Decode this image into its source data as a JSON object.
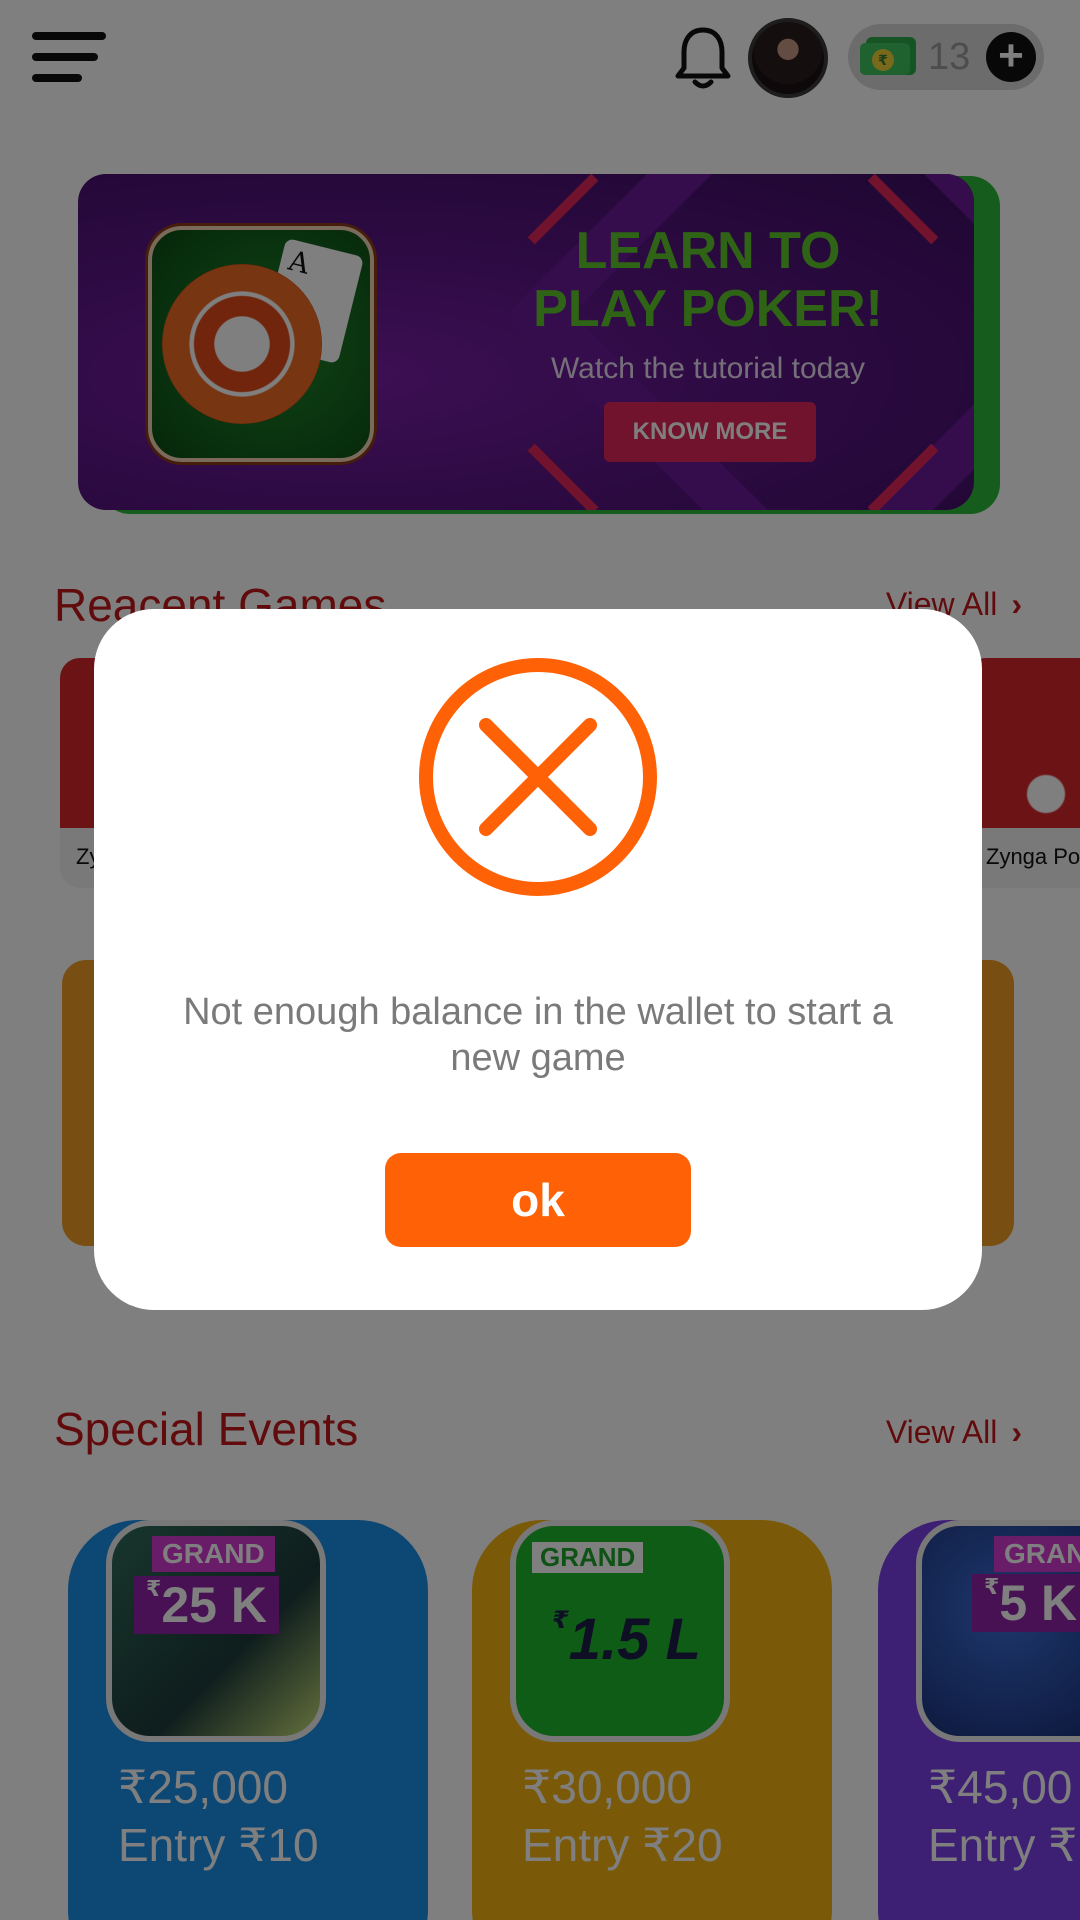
{
  "header": {
    "menu_icon": "hamburger-menu-icon",
    "bell_icon": "bell-icon",
    "wallet": {
      "currency_symbol": "₹",
      "amount": "13",
      "add_icon": "plus-icon"
    }
  },
  "banner": {
    "title_line1": "LEARN TO",
    "title_line2": "PLAY POKER!",
    "subtitle": "Watch the tutorial today",
    "button_label": "KNOW MORE",
    "card_rank": "A"
  },
  "recent_games": {
    "title": "Reacent Games",
    "view_all": "View All",
    "items": [
      {
        "name": "Zy"
      },
      {
        "name": "Zynga Po"
      }
    ]
  },
  "special_events": {
    "title": "Special Events",
    "view_all": "View All",
    "items": [
      {
        "tag": "GRAND",
        "badge": "25 K",
        "badge_currency": "₹",
        "prize": "₹25,000",
        "entry": "Entry ₹10",
        "color": "#1a8ee8"
      },
      {
        "tag": "GRAND",
        "badge": "1.5 L",
        "badge_currency": "₹",
        "prize": "₹30,000",
        "entry": "Entry ₹20",
        "color": "#f5b511"
      },
      {
        "tag": "GRAND",
        "badge": "5 K",
        "badge_currency": "₹",
        "prize": "₹45,00",
        "entry": "Entry ₹",
        "color": "#7a3ee6"
      }
    ]
  },
  "dialog": {
    "icon": "error-x-circle-icon",
    "message": "Not enough balance in the wallet to start a new game",
    "ok_label": "ok",
    "accent": "#ff6106"
  }
}
